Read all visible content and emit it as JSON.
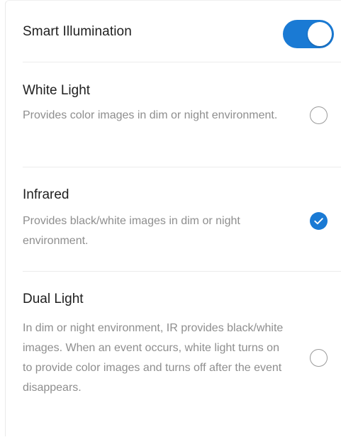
{
  "header": {
    "title": "Smart Illumination",
    "toggle_on": true
  },
  "options": [
    {
      "title": "White Light",
      "description": "Provides color images in dim or night environment.",
      "selected": false
    },
    {
      "title": "Infrared",
      "description": "Provides black/white images in dim or night environment.",
      "selected": true
    },
    {
      "title": "Dual Light",
      "description": "In dim or night environment, IR provides black/white images. When an event occurs, white light turns on to provide color images and turns off after the event disappears.",
      "selected": false
    }
  ],
  "colors": {
    "accent": "#1a7ad4",
    "title_text": "#202020",
    "description_text": "#8e8e8e",
    "radio_border": "#9a9a9a",
    "divider": "#ececec"
  },
  "icons": {
    "selected_radio": "checkmark-icon",
    "unselected_radio": "radio-empty-icon"
  }
}
